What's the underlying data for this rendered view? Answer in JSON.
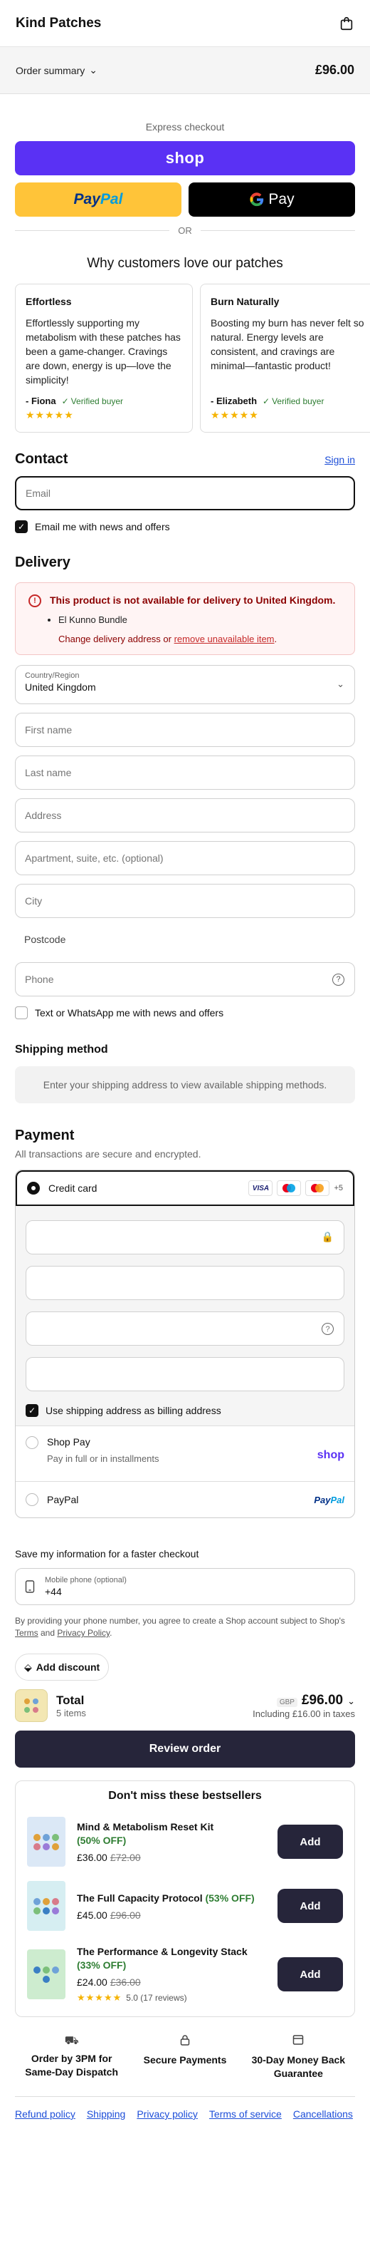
{
  "header": {
    "brand": "Kind Patches"
  },
  "summary": {
    "label": "Order summary",
    "amount": "£96.00"
  },
  "express": {
    "title": "Express checkout",
    "shop_label": "shop",
    "paypal_a": "Pay",
    "paypal_b": "Pal",
    "gpay_label": "Pay",
    "or": "OR"
  },
  "reviews": {
    "title": "Why customers love our patches",
    "items": [
      {
        "title": "Effortless",
        "body": "Effortlessly supporting my metabolism with these patches has been a game-changer. Cravings are down, energy is up—love the simplicity!",
        "name": "- Fiona",
        "badge": "Verified buyer",
        "stars": "★★★★★"
      },
      {
        "title": "Burn Naturally",
        "body": "Boosting my burn has never felt so natural. Energy levels are consistent, and cravings are minimal—fantastic product!",
        "name": "- Elizabeth",
        "badge": "Verified buyer",
        "stars": "★★★★★"
      }
    ]
  },
  "contact": {
    "title": "Contact",
    "signin": "Sign in",
    "email_placeholder": "Email",
    "newsletter": "Email me with news and offers"
  },
  "delivery": {
    "title": "Delivery",
    "alert_title": "This product is not available for delivery to United Kingdom.",
    "alert_item": "El Kunno Bundle",
    "alert_change": "Change delivery address or ",
    "alert_link": "remove unavailable item",
    "alert_end": ".",
    "country_label": "Country/Region",
    "country_value": "United Kingdom",
    "first_name": "First name",
    "last_name": "Last name",
    "address": "Address",
    "apartment": "Apartment, suite, etc. (optional)",
    "city": "City",
    "postcode": "Postcode",
    "phone": "Phone",
    "sms": "Text or WhatsApp me with news and offers"
  },
  "shipping": {
    "title": "Shipping method",
    "note": "Enter your shipping address to view available shipping methods."
  },
  "payment": {
    "title": "Payment",
    "subtitle": "All transactions are secure and encrypted.",
    "credit_card": "Credit card",
    "card_more": "+5",
    "billing_same": "Use shipping address as billing address",
    "shoppay": "Shop Pay",
    "shoppay_desc": "Pay in full or in installments",
    "shoppay_logo": "shop",
    "paypal": "PayPal",
    "paypal_logo_a": "Pay",
    "paypal_logo_b": "Pal"
  },
  "save": {
    "title": "Save my information for a faster checkout",
    "phone_label": "Mobile phone (optional)",
    "phone_value": "+44",
    "legal_a": "By providing your phone number, you agree to create a Shop account subject to Shop's ",
    "terms": "Terms",
    "legal_and": " and ",
    "privacy": "Privacy Policy",
    "legal_end": "."
  },
  "discount": {
    "label": "Add discount"
  },
  "total": {
    "label": "Total",
    "items": "5 items",
    "currency": "GBP",
    "amount": "£96.00",
    "tax": "Including £16.00 in taxes"
  },
  "review_button": "Review order",
  "bestsellers": {
    "title": "Don't miss these bestsellers",
    "products": [
      {
        "name": "Mind & Metabolism Reset Kit",
        "off": "(50% OFF)",
        "price": "£36.00",
        "was": "£72.00",
        "add": "Add",
        "color": "#dbe8f6"
      },
      {
        "name": "The Full Capacity Protocol",
        "off": "(53% OFF)",
        "price": "£45.00",
        "was": "£96.00",
        "add": "Add",
        "color": "#d6eef2"
      },
      {
        "name": "The Performance & Longevity Stack",
        "off": "(33% OFF)",
        "price": "£24.00",
        "was": "£36.00",
        "add": "Add",
        "color": "#cdeccf",
        "stars": "★★★★★",
        "rating": "5.0 (17 reviews)"
      }
    ]
  },
  "features": [
    {
      "icon": "⛟",
      "text": "Order by 3PM for Same-Day Dispatch"
    },
    {
      "icon": "🔒",
      "text": "Secure Payments"
    },
    {
      "icon": "▣",
      "text": "30-Day Money Back Guarantee"
    }
  ],
  "footer": {
    "refund": "Refund policy",
    "shipping": "Shipping",
    "privacy": "Privacy policy",
    "terms": "Terms of service",
    "cancellations": "Cancellations"
  }
}
